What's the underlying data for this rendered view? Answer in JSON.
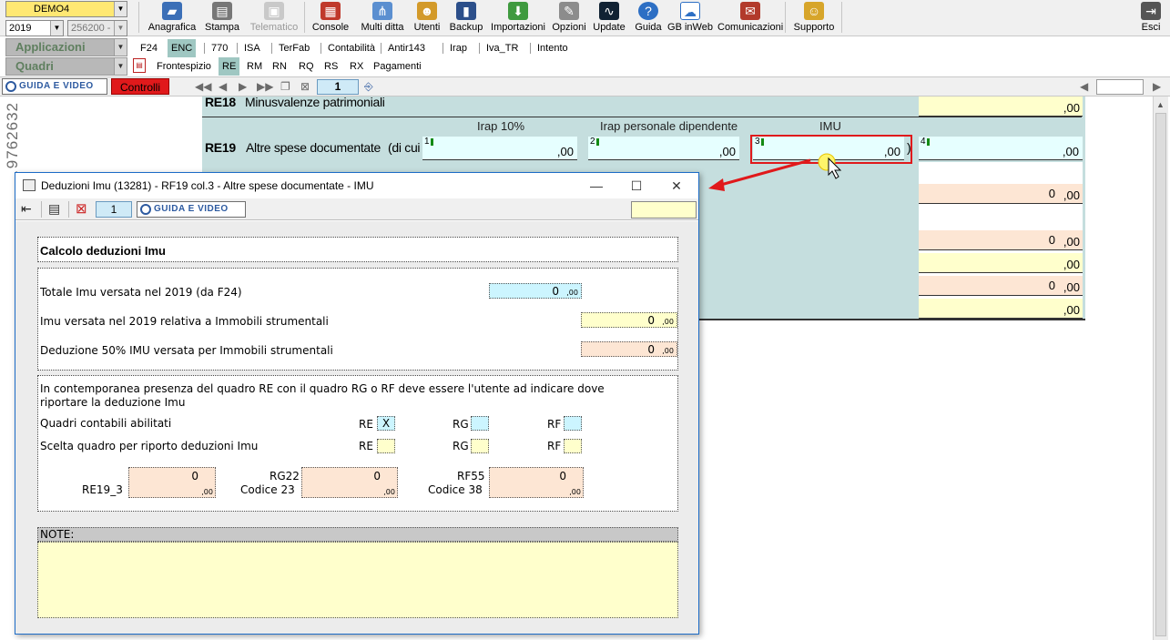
{
  "toolbar": {
    "company": "DEMO4",
    "year": "2019",
    "code": "256200 -",
    "applicazioni": "Applicazioni",
    "quadri": "Quadri",
    "buttons": [
      {
        "id": "anagrafica",
        "label": "Anagrafica",
        "icon": "car-icon"
      },
      {
        "id": "stampa",
        "label": "Stampa",
        "icon": "printer-icon"
      },
      {
        "id": "telematico",
        "label": "Telematico",
        "icon": "telematico-icon"
      },
      {
        "id": "console",
        "label": "Console",
        "icon": "console-icon"
      },
      {
        "id": "multiditta",
        "label": "Multi ditta",
        "icon": "network-icon"
      },
      {
        "id": "utenti",
        "label": "Utenti",
        "icon": "users-icon"
      },
      {
        "id": "backup",
        "label": "Backup",
        "icon": "backup-icon"
      },
      {
        "id": "importazioni",
        "label": "Importazioni",
        "icon": "import-icon"
      },
      {
        "id": "opzioni",
        "label": "Opzioni",
        "icon": "wrench-icon"
      },
      {
        "id": "update",
        "label": "Update",
        "icon": "update-icon"
      },
      {
        "id": "guida",
        "label": "Guida",
        "icon": "help-icon"
      },
      {
        "id": "gbinweb",
        "label": "GB inWeb",
        "icon": "cloud-icon"
      },
      {
        "id": "comunicazioni",
        "label": "Comunicazioni",
        "icon": "comunicazioni-icon"
      },
      {
        "id": "supporto",
        "label": "Supporto",
        "icon": "support-icon"
      }
    ],
    "esci": "Esci"
  },
  "tabs_apps": [
    "F24",
    "ENC",
    "770",
    "ISA",
    "TerFab",
    "Contabilità",
    "Antir143",
    "Irap",
    "Iva_TR",
    "Intento"
  ],
  "tabs_quadri": [
    "Frontespizio",
    "RE",
    "RM",
    "RN",
    "RQ",
    "RS",
    "RX",
    "Pagamenti"
  ],
  "navbar": {
    "guida_label": "GUIDA E VIDEO",
    "controlli_label": "Controlli",
    "page": "1"
  },
  "bgform": {
    "re18_code": "RE18",
    "re18_label": "Minusvalenze patrimoniali",
    "col_irap": "Irap 10%",
    "col_irap_pers": "Irap personale dipendente",
    "col_imu": "IMU",
    "re19_code": "RE19",
    "re19_label": "Altre spese documentate",
    "re19_dicui": "(di cui",
    "cells": [
      {
        "n": "1",
        "dec": ",00"
      },
      {
        "n": "2",
        "dec": ",00"
      },
      {
        "n": "3",
        "dec": ",00"
      },
      {
        "n": "4",
        "dec": ",00"
      }
    ],
    "right_rows": [
      {
        "value": "",
        "dec": ",00",
        "color": "#ffffcc"
      },
      {
        "value": "0",
        "dec": ",00",
        "color": "#fde6d4"
      },
      {
        "value": "0",
        "dec": ",00",
        "color": "#fde6d4"
      },
      {
        "value": "",
        "dec": ",00",
        "color": "#ffffcc"
      },
      {
        "value": "0",
        "dec": ",00",
        "color": "#fde6d4"
      },
      {
        "value": "",
        "dec": ",00",
        "color": "#ffffcc"
      }
    ],
    "left_strip_text": "…9762632"
  },
  "dialog": {
    "title": "Deduzioni Imu (13281) - RF19 col.3 - Altre spese documentate - IMU",
    "page": "1",
    "guida_label": "GUIDA E VIDEO",
    "header": "Calcolo deduzioni Imu",
    "totale_label": "Totale Imu versata nel 2019 (da F24)",
    "totale_value": "0",
    "strumentali_label": "Imu versata nel 2019 relativa a Immobili strumentali",
    "strumentali_value": "0",
    "deduzione_label": "Deduzione 50% IMU versata per Immobili strumentali",
    "deduzione_value": "0",
    "dec": ",00",
    "info_text_1": "In contemporanea presenza del quadro RE con il quadro RG o RF deve essere l'utente ad indicare dove",
    "info_text_2": "riportare la deduzione Imu",
    "abilitati_label": "Quadri contabili abilitati",
    "scelta_label": "Scelta quadro per riporto deduzioni Imu",
    "re": "RE",
    "rg": "RG",
    "rf": "RF",
    "re_checked": "X",
    "re19_3_label": "RE19_3",
    "re19_3_value": "0",
    "rg22_label": "RG22",
    "rg22_sub": "Codice 23",
    "rg22_value": "0",
    "rf55_label": "RF55",
    "rf55_sub": "Codice 38",
    "rf55_value": "0",
    "note_label": "NOTE:",
    "note_value": ""
  },
  "colors": {
    "accent_blue": "#1d6cc7",
    "highlight_red": "#e0191b",
    "form_bg": "#c5dede",
    "cell_cyan": "#e6ffff",
    "input_yellow": "#ffffcc",
    "input_peach": "#fde6d4",
    "input_cyan": "#ccf5ff"
  }
}
